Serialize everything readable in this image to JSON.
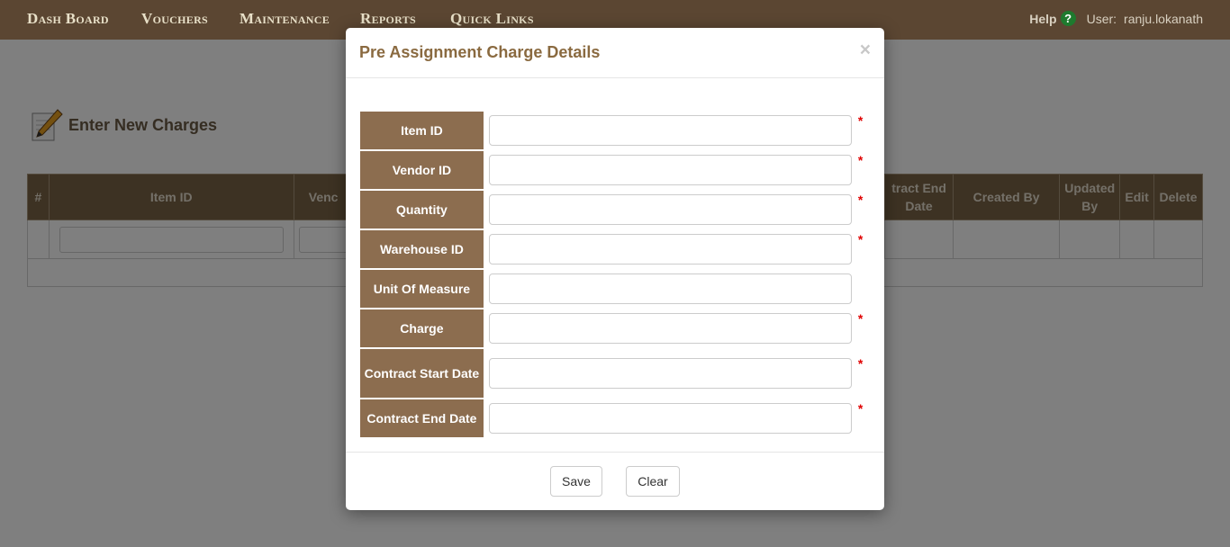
{
  "nav": {
    "items": [
      "Dash Board",
      "Vouchers",
      "Maintenance",
      "Reports",
      "Quick Links"
    ],
    "help_label": "Help",
    "help_icon": "?",
    "user_label": "User:",
    "username": "ranju.lokanath"
  },
  "page": {
    "title": "Enter New Charges",
    "grid_headers": [
      "#",
      "Item ID",
      "Venc",
      "tract End\nDate",
      "Created By",
      "Updated\nBy",
      "Edit",
      "Delete"
    ]
  },
  "modal": {
    "title": "Pre Assignment Charge Details",
    "close": "×",
    "fields": [
      {
        "label": "Item ID",
        "required": true
      },
      {
        "label": "Vendor ID",
        "required": true
      },
      {
        "label": "Quantity",
        "required": true
      },
      {
        "label": "Warehouse ID",
        "required": true
      },
      {
        "label": "Unit Of Measure",
        "required": false
      },
      {
        "label": "Charge",
        "required": true
      },
      {
        "label": "Contract Start Date",
        "required": true
      },
      {
        "label": "Contract End Date",
        "required": true
      }
    ],
    "required_mark": "*",
    "save_label": "Save",
    "clear_label": "Clear"
  },
  "colors": {
    "nav_bg": "#5b4632",
    "label_bg": "#8c6d4f",
    "title_color": "#8a6a40",
    "required": "#e00000"
  }
}
